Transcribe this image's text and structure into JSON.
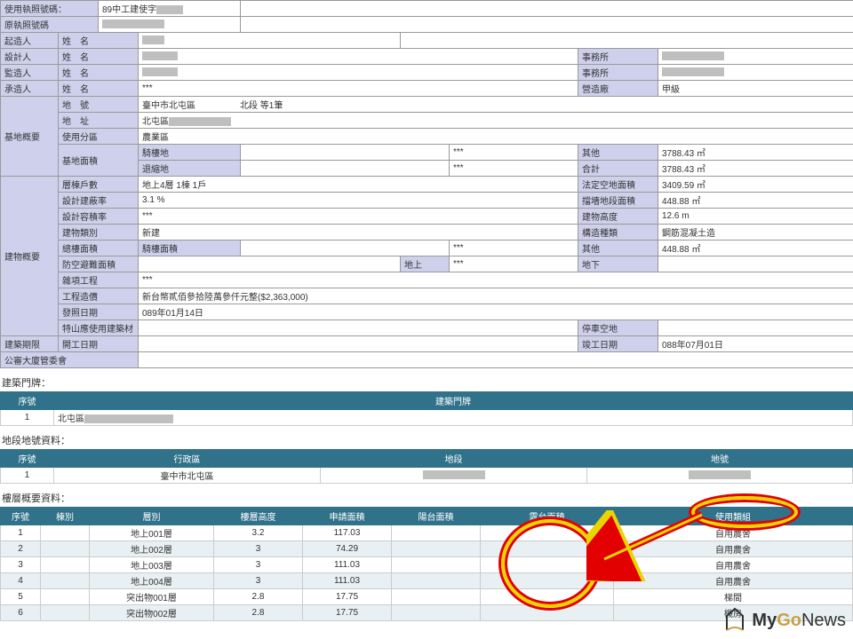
{
  "top": {
    "use_license_label": "使用執照號碼：",
    "use_license_value": "89中工建使字",
    "orig_license_label": "原執照號碼",
    "orig_license_value": "",
    "owner_label": "起造人",
    "designer_label": "設計人",
    "supervisor_label": "監造人",
    "contractor_label": "承造人",
    "name_label": "姓　名",
    "office_label": "事務所",
    "builder_label": "營造廠",
    "builder_value": "甲級"
  },
  "site": {
    "section_label": "基地概要",
    "lot_label": "地　號",
    "lot_value": "臺中市北屯區　　　　　北段 等1筆",
    "addr_label": "地　址",
    "addr_value": "北屯區",
    "zone_label": "使用分區",
    "zone_value": "農業區",
    "area_label": "基地面積",
    "riparian_label": "騎樓地",
    "riparian_value": "***",
    "retreat_label": "退縮地",
    "retreat_value": "***",
    "other_label": "其他",
    "other_value": "3788.43 ㎡",
    "total_label": "合計",
    "total_value": "3788.43 ㎡"
  },
  "bldg": {
    "section_label": "建物概要",
    "floors_label": "層棟戶數",
    "floors_value": "地上4層 1棟 1戶",
    "legal_open_label": "法定空地面積",
    "legal_open_value": "3409.59 ㎡",
    "cov_label": "設計建蔽率",
    "cov_value": "3.1 %",
    "retaining_area_label": "擋墻地段面積",
    "retaining_area_value": "448.88 ㎡",
    "far_label": "設計容積率",
    "far_value": "***",
    "height_label": "建物高度",
    "height_value": "12.6 m",
    "struct_type_label": "建物類別",
    "struct_type_value": "新建",
    "main_struct_label": "構造種類",
    "main_struct_value": "鋼筋混凝土造",
    "total_area_label": "總樓面積",
    "total_area_sub_label": "騎樓面積",
    "total_area_sub_value": "***",
    "other2_label": "其他",
    "other2_value": "448.88 ㎡",
    "prevent_label": "防空避難面積",
    "above_label": "地上",
    "above_value": "***",
    "below_label": "地下",
    "below_value": "",
    "misc_label": "雜項工程",
    "misc_value": "***",
    "cost_label": "工程造價",
    "cost_value": "新台幣貳佰參拾陸萬參仟元整($2,363,000)",
    "issue_label": "發照日期",
    "issue_value": "089年01月14日",
    "note_blank_label": "特山應使用建築材",
    "parking_label": "停車空地",
    "parking_value": ""
  },
  "period": {
    "section_label": "建築期限",
    "start_label": "開工日期",
    "end_label": "竣工日期",
    "end_value": "088年07月01日",
    "public_label": "公審大廈管委會"
  },
  "doors": {
    "title": "建築門牌：",
    "cols": {
      "seq": "序號",
      "door": "建築門牌"
    },
    "rows": [
      {
        "seq": "1",
        "door": "北屯區"
      }
    ]
  },
  "land": {
    "title": "地段地號資料：",
    "cols": {
      "seq": "序號",
      "district": "行政區",
      "section": "地段",
      "lot": "地號"
    },
    "rows": [
      {
        "seq": "1",
        "district": "臺中市北屯區",
        "section": "",
        "lot": ""
      }
    ]
  },
  "floors": {
    "title": "樓層概要資料：",
    "cols": {
      "seq": "序號",
      "building": "棟別",
      "floor": "層別",
      "height": "樓層高度",
      "apply_area": "申請面積",
      "balcony": "陽台面積",
      "terrace": "露台面積",
      "use": "使用類組"
    },
    "rows": [
      {
        "seq": "1",
        "building": "",
        "floor": "地上001層",
        "height": "3.2",
        "apply_area": "117.03",
        "balcony": "",
        "terrace": "",
        "use": "自用農舍"
      },
      {
        "seq": "2",
        "building": "",
        "floor": "地上002層",
        "height": "3",
        "apply_area": "74.29",
        "balcony": "",
        "terrace": "",
        "use": "自用農舍"
      },
      {
        "seq": "3",
        "building": "",
        "floor": "地上003層",
        "height": "3",
        "apply_area": "111.03",
        "balcony": "",
        "terrace": "",
        "use": "自用農舍"
      },
      {
        "seq": "4",
        "building": "",
        "floor": "地上004層",
        "height": "3",
        "apply_area": "111.03",
        "balcony": "",
        "terrace": "",
        "use": "自用農舍"
      },
      {
        "seq": "5",
        "building": "",
        "floor": "突出物001層",
        "height": "2.8",
        "apply_area": "17.75",
        "balcony": "",
        "terrace": "",
        "use": "梯間"
      },
      {
        "seq": "6",
        "building": "",
        "floor": "突出物002層",
        "height": "2.8",
        "apply_area": "17.75",
        "balcony": "",
        "terrace": "",
        "use": "機房"
      }
    ]
  },
  "logo": {
    "my": "My",
    "go": "Go",
    "news": "News"
  }
}
